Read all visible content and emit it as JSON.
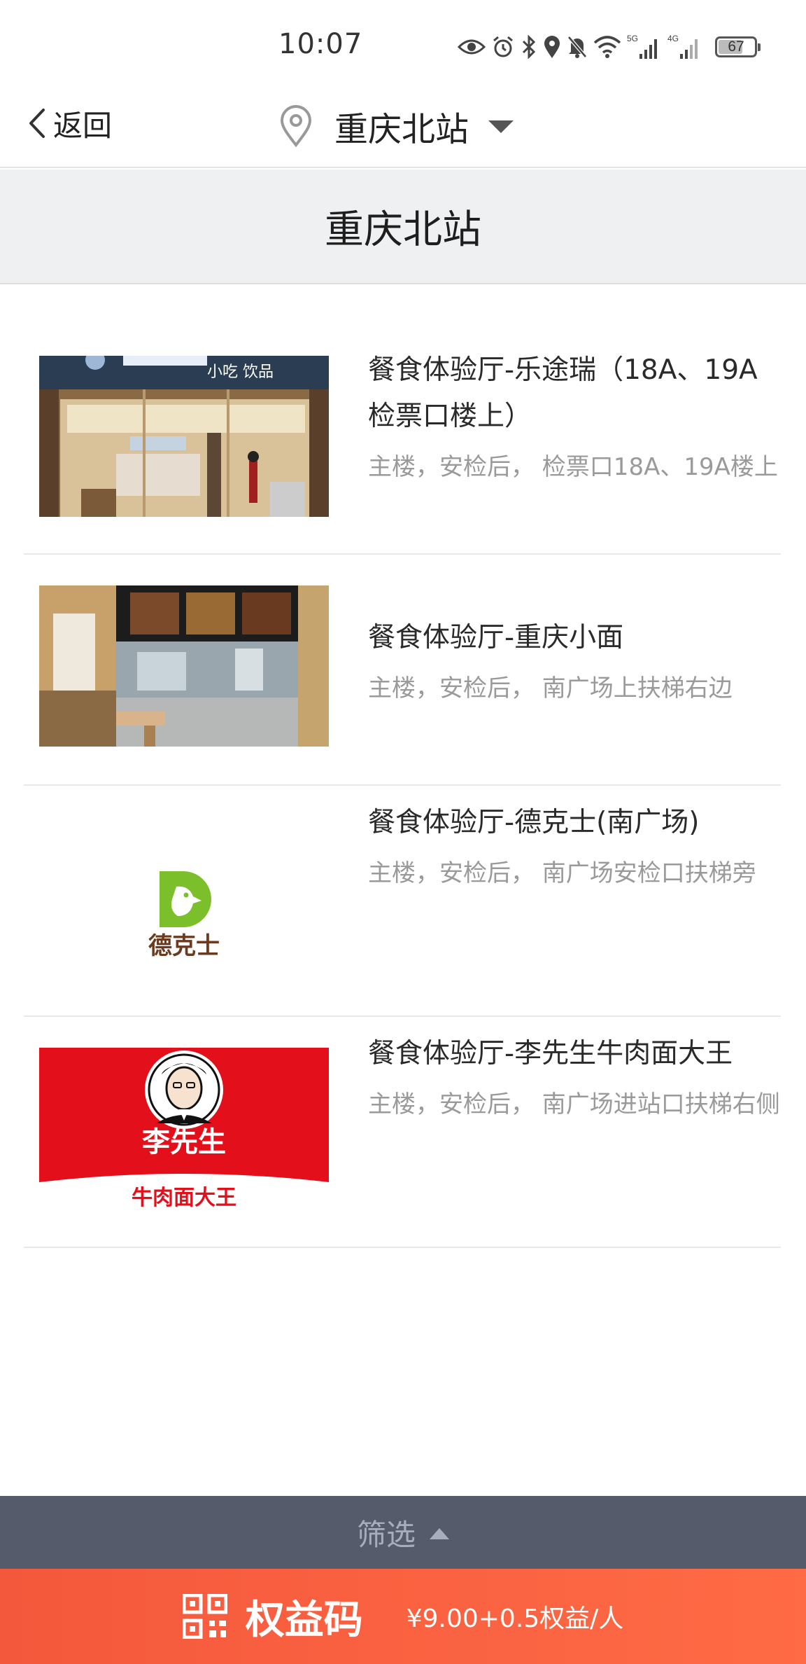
{
  "status_bar": {
    "time": "10:07",
    "battery": "67",
    "icons": [
      "eye-icon",
      "alarm-icon",
      "bluetooth-icon",
      "location-icon",
      "mute-icon",
      "wifi-icon",
      "signal-5g-icon",
      "signal-4g-icon",
      "battery-icon"
    ]
  },
  "nav": {
    "back_label": "返回",
    "station": "重庆北站"
  },
  "header": {
    "title": "重庆北站"
  },
  "restaurants": [
    {
      "name": "餐食体验厅-乐途瑞（18A、19A检票口楼上）",
      "location": "主楼，安检后， 检票口18A、19A楼上",
      "image": "storefront-photo",
      "sign_text": "小吃 饮品"
    },
    {
      "name": "餐食体验厅-重庆小面",
      "location": "主楼，安检后， 南广场上扶梯右边",
      "image": "kitchen-counter-photo"
    },
    {
      "name": "餐食体验厅-德克士(南广场)",
      "location": "主楼，安检后， 南广场安检口扶梯旁",
      "image": "dicos-logo",
      "logo_text": "德克士"
    },
    {
      "name": "餐食体验厅-李先生牛肉面大王",
      "location": "主楼，安检后， 南广场进站口扶梯右侧",
      "image": "mr-lee-logo",
      "logo_text": "李先生",
      "logo_subtext": "牛肉面大王"
    }
  ],
  "filter": {
    "label": "筛选"
  },
  "code_bar": {
    "label": "权益码",
    "price": "¥9.00+0.5权益/人"
  },
  "colors": {
    "accent": "#f4583c",
    "filter_bg": "#555b6b",
    "header_bg": "#eff0f2",
    "dicos_green": "#7bbf2a",
    "lee_red": "#e3101b"
  }
}
